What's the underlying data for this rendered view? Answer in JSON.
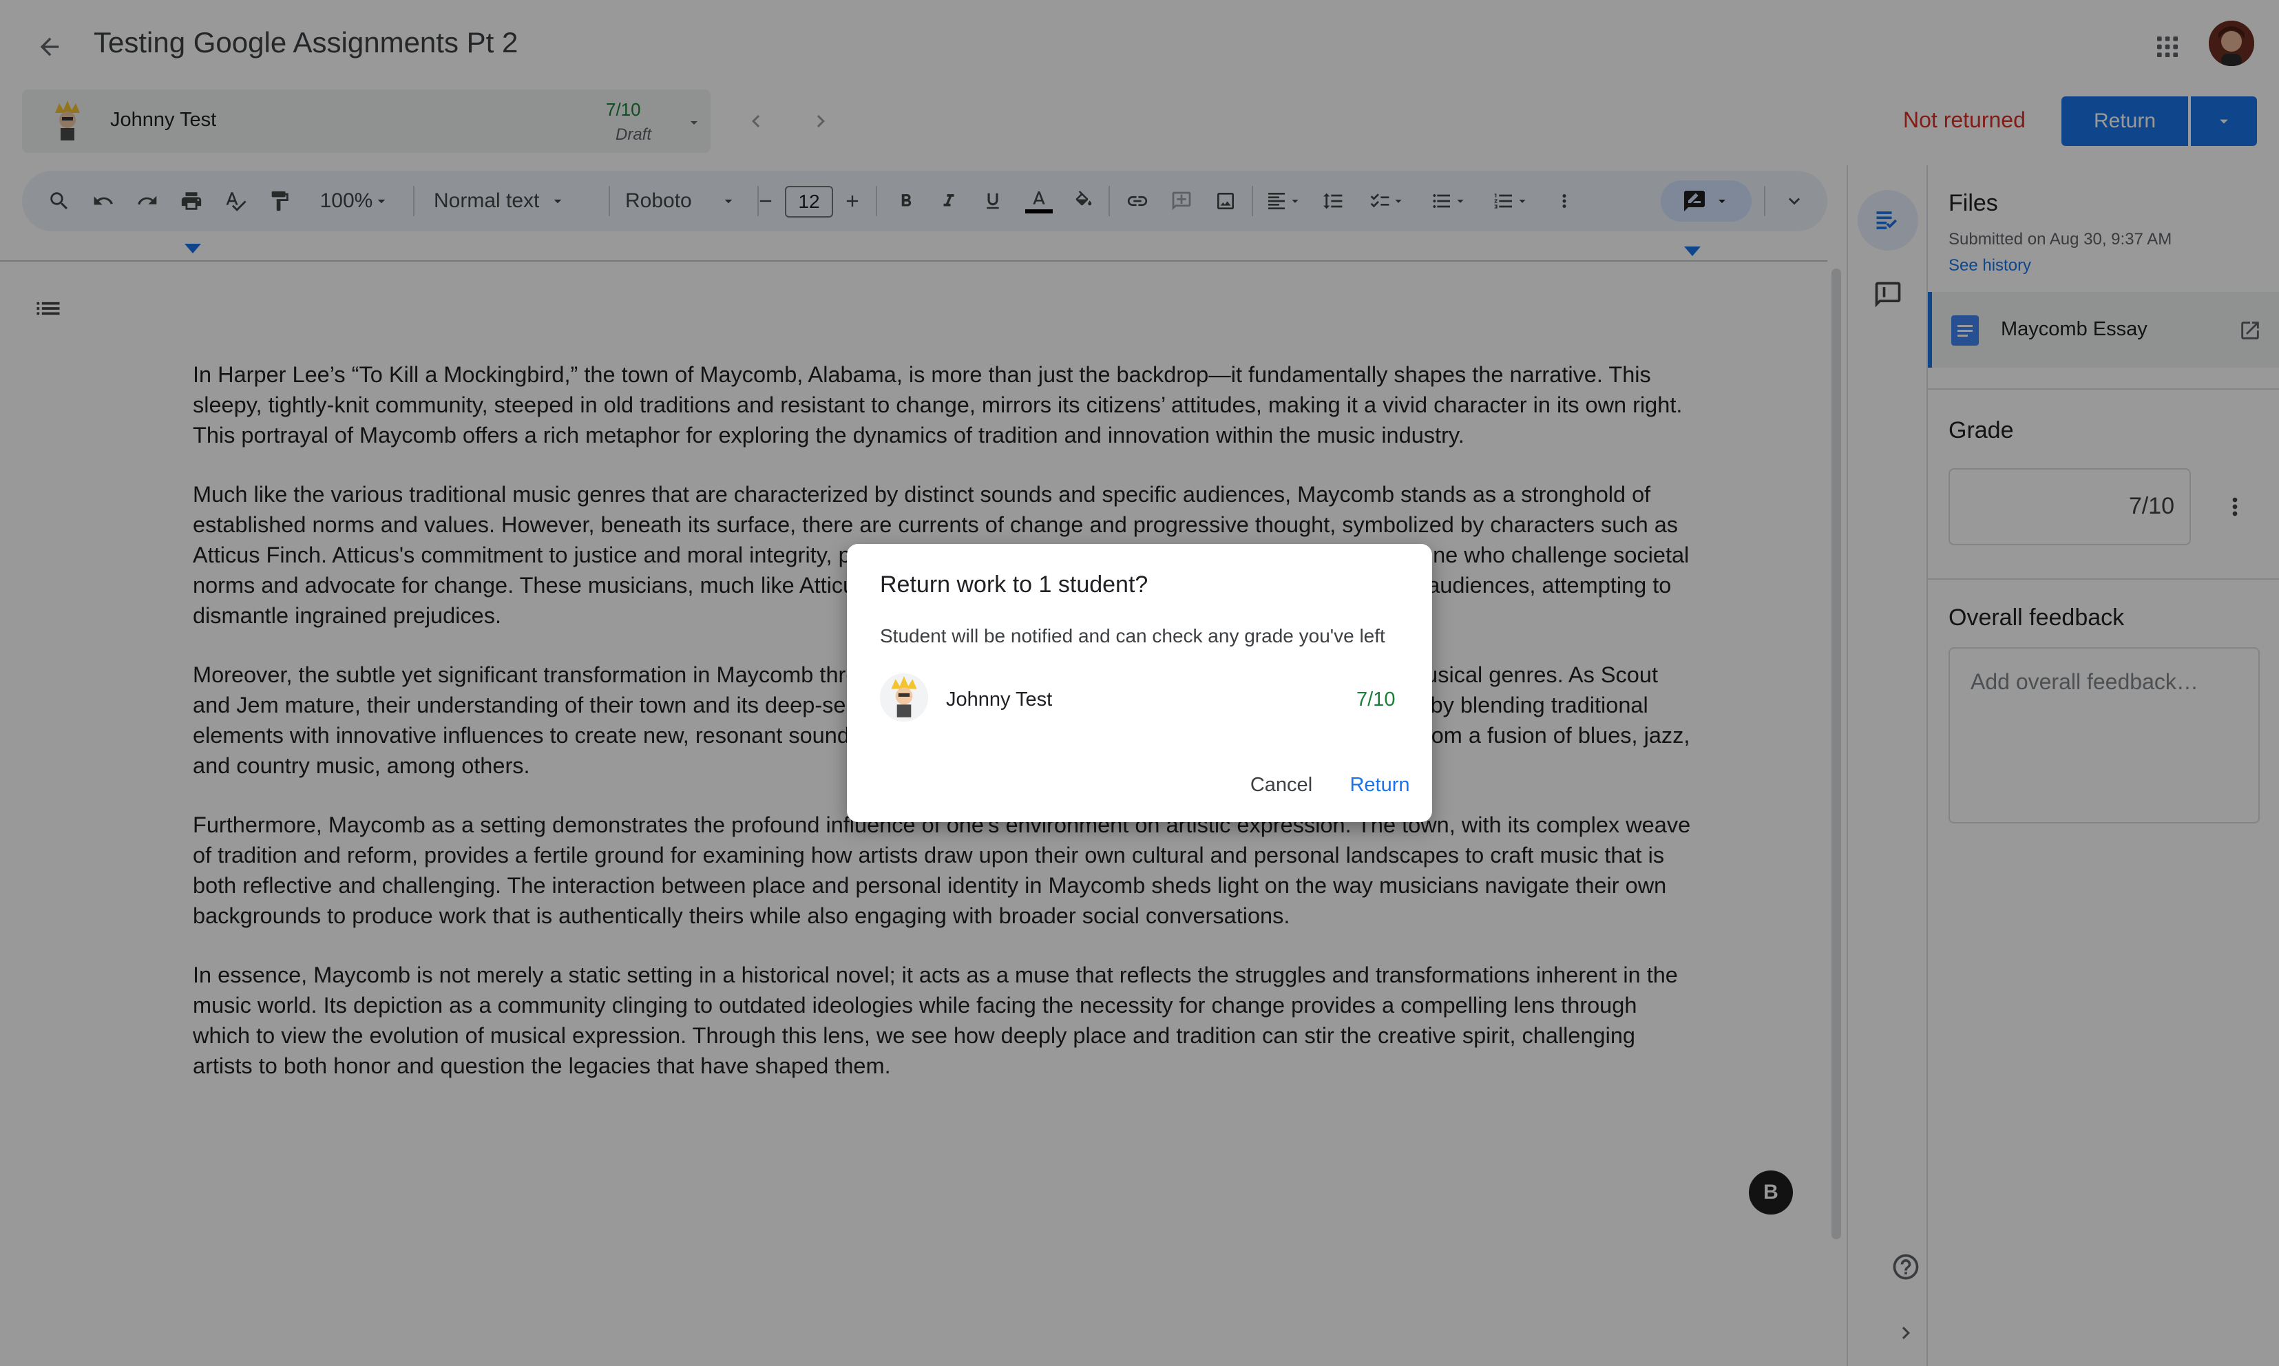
{
  "header": {
    "title": "Testing Google Assignments Pt 2",
    "back_icon": "arrow-back-icon",
    "apps_icon": "apps-grid-icon"
  },
  "student": {
    "name": "Johnny Test",
    "score": "7/10",
    "status": "Draft"
  },
  "status_bar": {
    "not_returned": "Not returned",
    "return_label": "Return"
  },
  "toolbar": {
    "zoom": "100%",
    "style": "Normal text",
    "font": "Roboto",
    "font_size": "12"
  },
  "document": {
    "paragraphs": [
      "In Harper Lee’s “To Kill a Mockingbird,” the town of Maycomb, Alabama, is more than just the backdrop—it fundamentally shapes the narrative. This sleepy, tightly-knit community, steeped in old traditions and resistant to change, mirrors its citizens’ attitudes, making it a vivid character in its own right. This portrayal of Maycomb offers a rich metaphor for exploring the dynamics of tradition and innovation within the music industry.",
      "Much like the various traditional music genres that are characterized by distinct sounds and specific audiences, Maycomb stands as a stronghold of established norms and values. However, beneath its surface, there are currents of change and progressive thought, symbolized by characters such as Atticus Finch. Atticus's commitment to justice and moral integrity, parallels the innovators and trailblazers within the music scene who challenge societal norms and advocate for change. These musicians, much like Atticus, use their art to inspire shifts in perspective among their audiences, attempting to dismantle ingrained prejudices.",
      "Moreover, the subtle yet significant transformation in Maycomb through the eyes of Scout and Jem mirrors the evolution of musical genres. As Scout and Jem mature, their understanding of their town and its deep-seated biases evolves, much like how musical genres evolve by blending traditional elements with innovative influences to create new, resonant sounds. This is seen in genres like rock and roll, which evolved from a fusion of blues, jazz, and country music, among others.",
      "Furthermore, Maycomb as a setting demonstrates the profound influence of one's environment on artistic expression. The town, with its complex weave of tradition and reform, provides a fertile ground for examining how artists draw upon their own cultural and personal landscapes to craft music that is both reflective and challenging. The interaction between place and personal identity in Maycomb sheds light on the way musicians navigate their own backgrounds to produce work that is authentically theirs while also engaging with broader social conversations.",
      "In essence, Maycomb is not merely a static setting in a historical novel; it acts as a muse that reflects the struggles and transformations inherent in the music world. Its depiction as a community clinging to outdated ideologies while facing the necessity for change provides a compelling lens through which to view the evolution of musical expression. Through this lens, we see how deeply place and tradition can stir the creative spirit, challenging artists to both honor and question the legacies that have shaped them."
    ]
  },
  "panel": {
    "files_title": "Files",
    "submitted": "Submitted on Aug 30, 9:37 AM",
    "see_history": "See history",
    "file_name": "Maycomb Essay",
    "grade_title": "Grade",
    "grade_value": "7/10",
    "feedback_title": "Overall feedback",
    "feedback_placeholder": "Add overall feedback…"
  },
  "dialog": {
    "title": "Return work to 1 student?",
    "description": "Student will be notified and can check any grade you've left",
    "student_name": "Johnny Test",
    "score": "7/10",
    "cancel": "Cancel",
    "confirm": "Return"
  },
  "colors": {
    "accent": "#1a73e8",
    "danger": "#d93025",
    "success": "#188038"
  }
}
